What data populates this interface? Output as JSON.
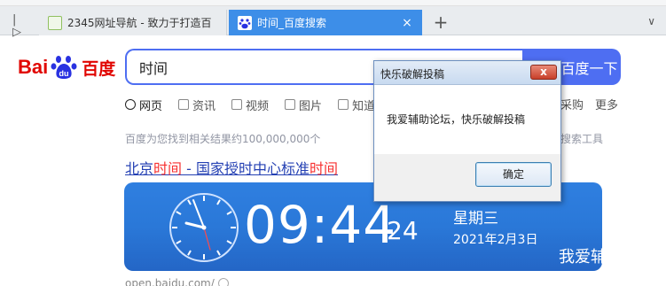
{
  "browser": {
    "tabs": [
      {
        "label": "2345网址导航 - 致力于打造百",
        "active": false
      },
      {
        "label": "时间_百度搜索",
        "active": true,
        "close": "×"
      }
    ],
    "toggle_glyph": "|▷",
    "newtab_glyph": "+",
    "more_glyph": "∨"
  },
  "logo": {
    "bai": "Bai",
    "du": "du",
    "cn": "百度"
  },
  "search": {
    "query": "时间",
    "button_label": "百度一下"
  },
  "nav": {
    "tabs": [
      {
        "label": "网页",
        "icon": "search-icon"
      },
      {
        "label": "资讯",
        "icon": "news-icon"
      },
      {
        "label": "视频",
        "icon": "video-icon"
      },
      {
        "label": "图片",
        "icon": "image-icon"
      },
      {
        "label": "知道",
        "icon": "question-icon"
      }
    ],
    "right_items": [
      "采购",
      "更多"
    ]
  },
  "results": {
    "count_text": "百度为您找到相关结果约100,000,000个",
    "tools_label": "搜索工具",
    "first_title": {
      "p1": "北京",
      "p2": "时间",
      "p3": " - 国家授时中心标准",
      "p4": "时间"
    },
    "url_snippet": "open.baidu.com/"
  },
  "clock": {
    "time": "09:44",
    "seconds": "24",
    "weekday": "星期三",
    "date": "2021年2月3日",
    "slogan": "我爱辅助论坛"
  },
  "dialog": {
    "title": "快乐破解投稿",
    "close": "x",
    "message": "我爱辅助论坛，快乐破解投稿",
    "ok_label": "确定"
  },
  "colors": {
    "baidu_blue": "#4e6ef2",
    "tab_active": "#3d8ee8",
    "link": "#2440b3",
    "highlight": "#f73131",
    "clock_card": "#2a78d8"
  }
}
